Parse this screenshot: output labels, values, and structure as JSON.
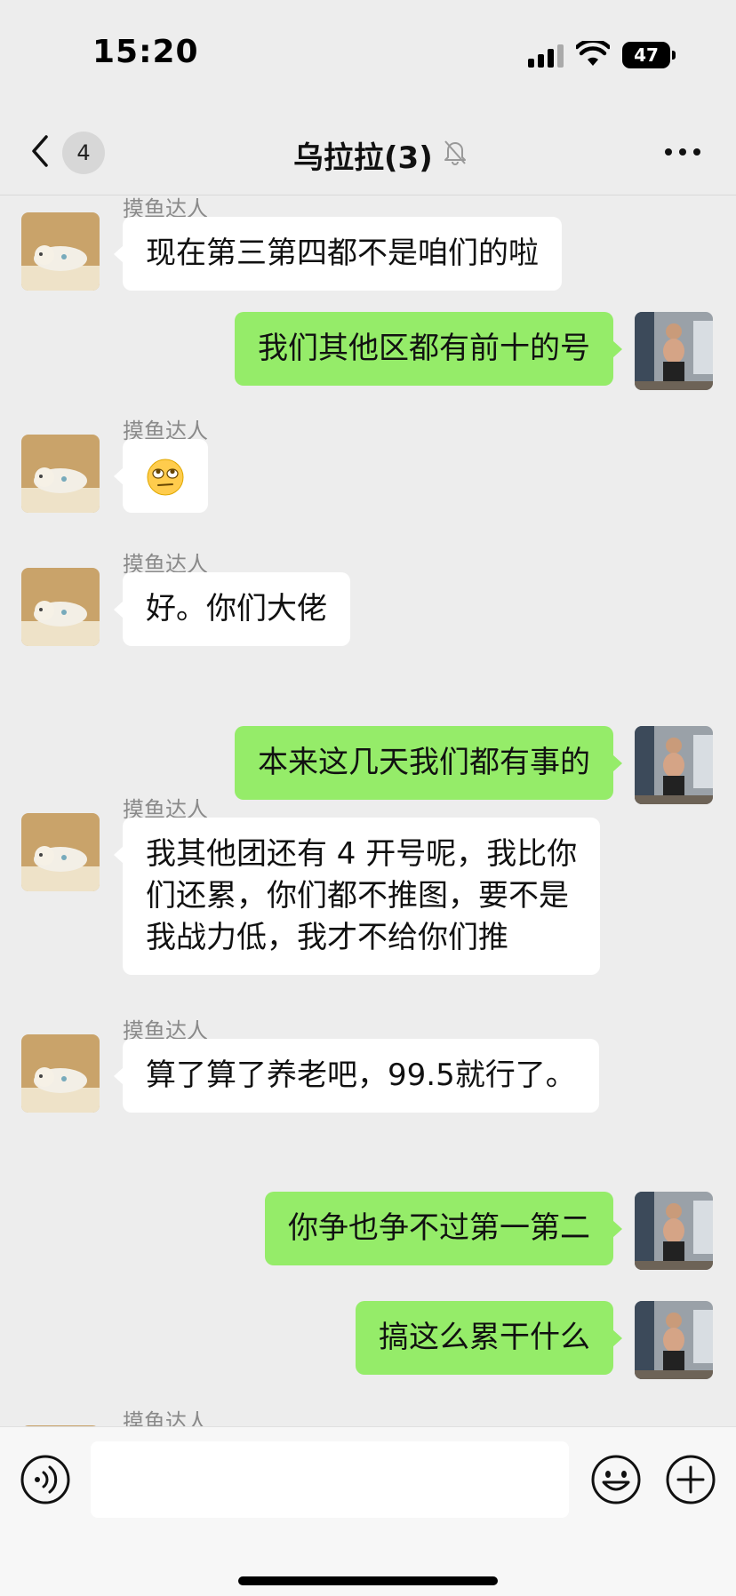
{
  "status_bar": {
    "time": "15:20",
    "battery": "47"
  },
  "nav": {
    "unread_count": "4",
    "title": "乌拉拉(3)"
  },
  "messages": [
    {
      "side": "in",
      "sender": "摸鱼达人",
      "text": "现在第三第四都不是咱们的啦"
    },
    {
      "side": "out",
      "text": "我们其他区都有前十的号"
    },
    {
      "side": "in",
      "sender": "摸鱼达人",
      "emoji": "rolling-eyes-face"
    },
    {
      "side": "in",
      "sender": "摸鱼达人",
      "text": "好。你们大佬"
    },
    {
      "side": "out",
      "text": "本来这几天我们都有事的"
    },
    {
      "side": "in",
      "sender": "摸鱼达人",
      "lines": [
        "我其他团还有 4 开号呢，我比你",
        "们还累，你们都不推图，要不是",
        "我战力低，我才不给你们推"
      ]
    },
    {
      "side": "in",
      "sender": "摸鱼达人",
      "text": "算了算了养老吧，99.5就行了。"
    },
    {
      "side": "out",
      "text": "你争也争不过第一第二"
    },
    {
      "side": "out",
      "text": "搞这么累干什么"
    },
    {
      "side": "in",
      "sender": "摸鱼达人"
    }
  ],
  "input": {
    "value": ""
  },
  "colors": {
    "outgoing_bubble": "#95ec69",
    "incoming_bubble": "#ffffff",
    "background": "#ededed"
  }
}
